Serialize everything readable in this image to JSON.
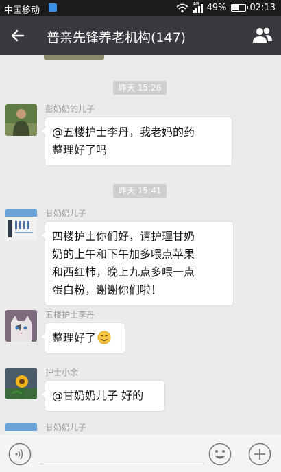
{
  "status_bar": {
    "carrier": "中国移动",
    "network": "4G",
    "battery": "49%",
    "time": "02:13",
    "battery_level": 0.49
  },
  "header": {
    "title": "普亲先锋养老机构(147)",
    "back_icon": "arrow-left-icon",
    "members_icon": "people-icon"
  },
  "chat": {
    "timestamps": [
      "昨天 15:26",
      "昨天 15:41"
    ],
    "messages": [
      {
        "sender": "彭奶奶的儿子",
        "lines": [
          "@五楼护士李丹，我老妈的药",
          "整理好了吗"
        ]
      },
      {
        "sender": "甘奶奶儿子",
        "lines": [
          "四楼护士你们好，请护理甘奶",
          "奶的上午和下午加多喂点苹果",
          "和西红柿，晚上九点多喂一点",
          "蛋白粉，谢谢你们啦！"
        ]
      },
      {
        "sender": "五楼护士李丹",
        "lines": [
          "整理好了"
        ],
        "emoji": "smile-emoji"
      },
      {
        "sender": "护士小余",
        "lines": [
          "@甘奶奶儿子 好的"
        ]
      },
      {
        "sender": "甘奶奶儿子",
        "lines": []
      }
    ]
  },
  "input_bar": {
    "voice_icon": "voice-icon",
    "emoji_icon": "emoji-icon",
    "more_icon": "plus-icon"
  }
}
